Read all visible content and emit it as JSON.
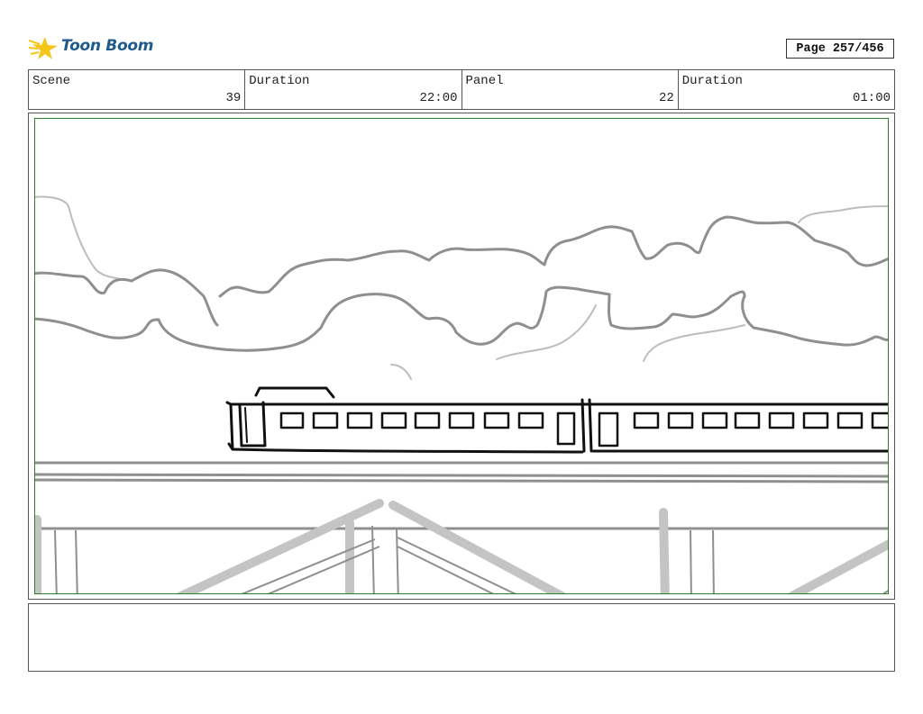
{
  "header": {
    "logo": {
      "brand": "Toon Boom",
      "icon": "toon-boom-star-icon",
      "accent_color": "#f5c518",
      "text_color": "#1f5a8c"
    },
    "page_label": "Page 257/456"
  },
  "info": {
    "scene_label": "Scene",
    "scene_value": "39",
    "scene_duration_label": "Duration",
    "scene_duration_value": "22:00",
    "panel_label": "Panel",
    "panel_value": "22",
    "panel_duration_label": "Duration",
    "panel_duration_value": "01:00"
  },
  "panel": {
    "frame_color": "#2e7d32",
    "sketch_description_icon": "storyboard-sketch"
  },
  "notes": {
    "text": ""
  }
}
